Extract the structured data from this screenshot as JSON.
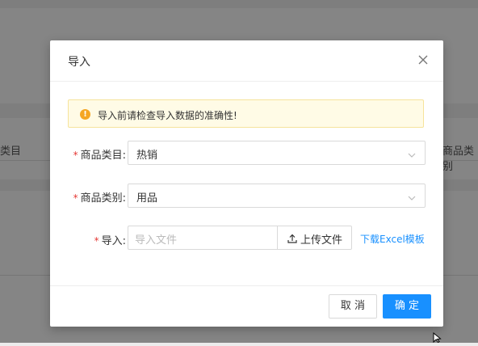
{
  "background": {
    "left_label": "类目",
    "right_label": "商品类别"
  },
  "modal": {
    "title": "导入",
    "close_icon": "close-icon",
    "alert": {
      "icon": "warning-icon",
      "text": "导入前请检查导入数据的准确性!"
    },
    "fields": {
      "category": {
        "required": "*",
        "label": "商品类目:",
        "value": "热销"
      },
      "type": {
        "required": "*",
        "label": "商品类别:",
        "value": "用品"
      },
      "import": {
        "required": "*",
        "label": "导入:",
        "placeholder": "导入文件",
        "upload_label": "上传文件",
        "template_link": "下载Excel模板"
      }
    },
    "footer": {
      "cancel_label": "取 消",
      "ok_label": "确 定"
    }
  },
  "colors": {
    "primary": "#1890ff",
    "warning": "#f5a623",
    "required": "#e53935",
    "alert_bg": "#fffbe6"
  }
}
